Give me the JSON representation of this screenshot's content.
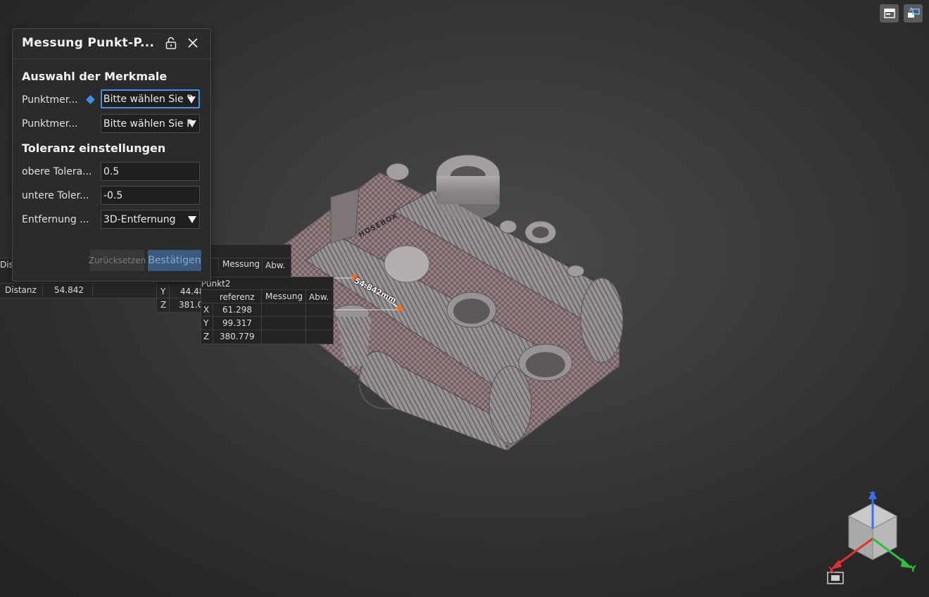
{
  "dialog": {
    "title": "Messung Punkt-P...",
    "section_features": "Auswahl der Merkmale",
    "point1_label": "Punktmer...",
    "point1_value": "Bitte wählen Sie P",
    "point2_label": "Punktmer...",
    "point2_value": "Bitte wählen Sie P",
    "section_tolerance": "Toleranz einstellungen",
    "upper_label": "obere Tolera...",
    "upper_value": "0.5",
    "lower_label": "untere Toler...",
    "lower_value": "-0.5",
    "distance_label": "Entfernung ...",
    "distance_value": "3D-Entfernung",
    "reset_label": "Zurücksetzen",
    "confirm_label": "Bestätigen"
  },
  "distance_table": {
    "title": "Dis",
    "row_label": "Distanz",
    "value": "54.842"
  },
  "punkt1_table": {
    "col_messung": "Messung",
    "col_abw": "Abw.",
    "y_label": "Y",
    "y_value": "44.48",
    "z_label": "Z",
    "z_value": "381.0"
  },
  "punkt2_table": {
    "title": "Punkt2",
    "col_referenz": "referenz",
    "col_messung": "Messung",
    "col_abw": "Abw.",
    "rows": [
      {
        "axis": "X",
        "value": "61.298"
      },
      {
        "axis": "Y",
        "value": "99.317"
      },
      {
        "axis": "Z",
        "value": "380.779"
      }
    ]
  },
  "model": {
    "dimension_label": "54.842mm",
    "engraving": "HOSEBOX"
  },
  "axes": {
    "x": "X",
    "y": "Y",
    "z": "Z"
  },
  "colors": {
    "accent_blue": "#4a90e2",
    "point_orange": "#ff6a1a",
    "axis_x": "#e03030",
    "axis_y": "#2fbf3a",
    "axis_z": "#3a6ff0"
  },
  "icons": {
    "top_right_1": "window-icon",
    "top_right_2": "swap-view-icon",
    "lock": "unlock-icon",
    "close": "close-icon",
    "view_fit": "fit-view-icon"
  }
}
